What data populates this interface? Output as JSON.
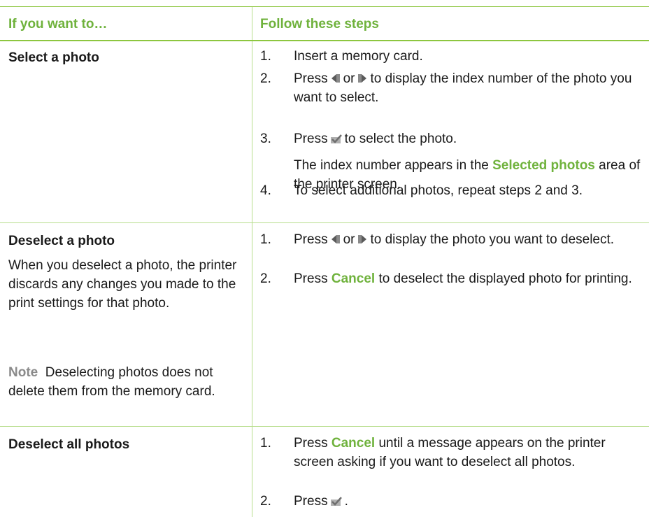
{
  "header": {
    "col1": "If you want to…",
    "col2": "Follow these steps"
  },
  "rows": [
    {
      "title": "Select a photo",
      "steps": [
        {
          "n": "1.",
          "t": "Insert a memory card."
        },
        {
          "n": "2.",
          "a": "Press",
          "mid": "or",
          "b": "to display the index number of the photo you want to select."
        },
        {
          "n": "3.",
          "a": "Press",
          "b": "to select the photo."
        },
        {
          "n": "4.",
          "t": "To select additional photos, repeat steps 2 and 3."
        }
      ],
      "subtext": {
        "a": "The index number appears in the",
        "hl": "Selected photos",
        "b": "area of the printer screen."
      }
    },
    {
      "title": "Deselect a photo",
      "description": "When you deselect a photo, the printer discards any changes you made to the print settings for that photo.",
      "note_label": "Note",
      "note": "Deselecting photos does not delete them from the memory card.",
      "steps": [
        {
          "n": "1.",
          "a": "Press",
          "mid": "or",
          "b": "to display the photo you want to deselect."
        },
        {
          "n": "2.",
          "a": "Press",
          "hl": "Cancel",
          "b": "to deselect the displayed photo for printing."
        }
      ]
    },
    {
      "title": "Deselect all photos",
      "steps": [
        {
          "n": "1.",
          "a": "Press",
          "hl": "Cancel",
          "b": "until a message appears on the printer screen asking if you want to deselect all photos."
        },
        {
          "n": "2.",
          "a": "Press",
          "b": "."
        }
      ]
    }
  ],
  "icons": {
    "left": "left-arrow-icon",
    "right": "right-arrow-icon",
    "ok": "ok-checkmark-icon"
  },
  "colors": {
    "accent": "#6fb23c",
    "rule": "#8dc63f",
    "note": "#8a8a8a"
  }
}
